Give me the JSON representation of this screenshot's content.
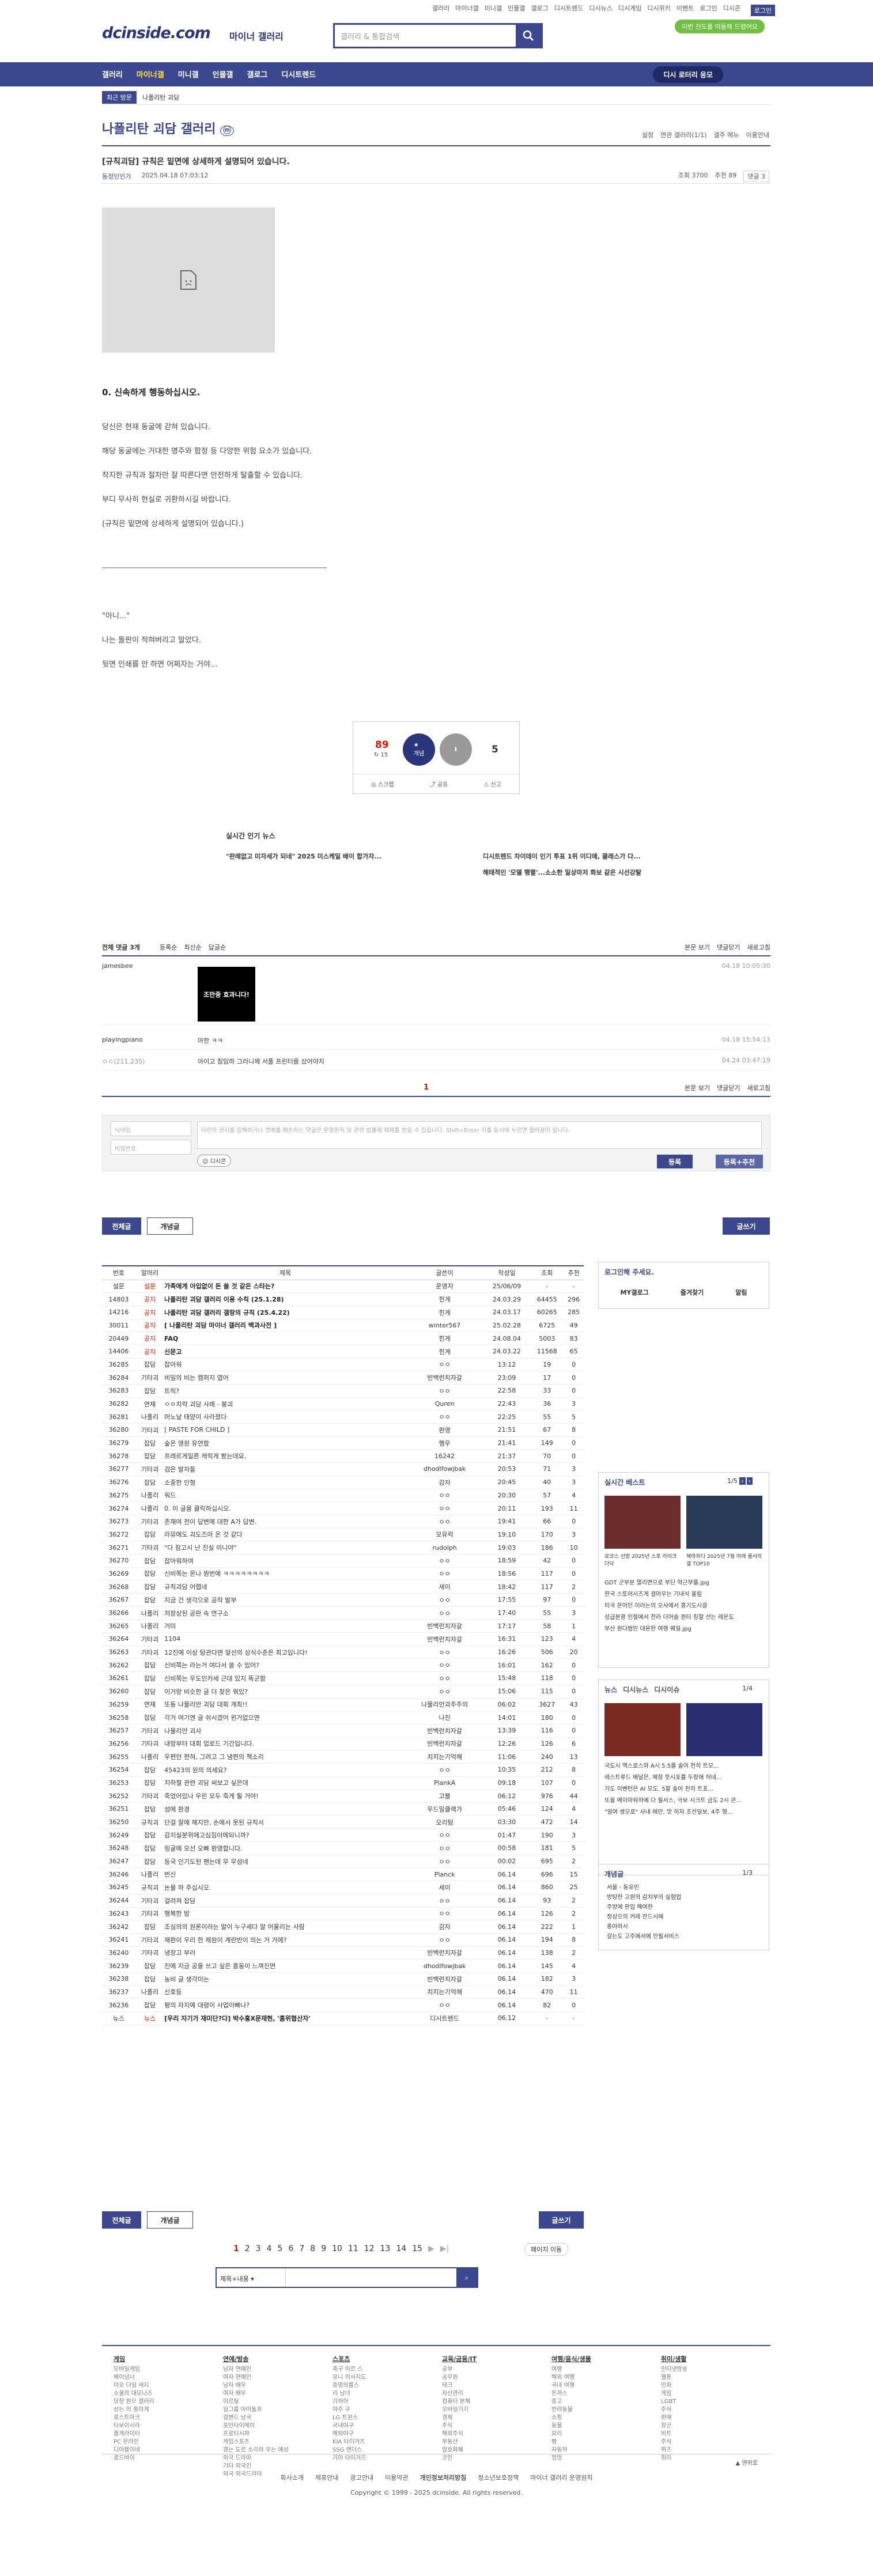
{
  "top": {
    "menu": [
      "갤러리",
      "마이너갤",
      "미니갤",
      "인물갤",
      "갤로그",
      "디시트렌드",
      "디시뉴스",
      "디시게임",
      "디시위키",
      "이벤트",
      "로그인",
      "디시콘"
    ],
    "login": "로그인",
    "pill": "이번 진도를 이동해 드렸어요"
  },
  "logo": "dcinside.com",
  "logo_sub": "마이너 갤러리",
  "search": {
    "placeholder": "갤러리 & 통합검색"
  },
  "nav": {
    "items": [
      "갤러리",
      "마이너갤",
      "미니갤",
      "인물갤",
      "갤로그",
      "디시트렌드"
    ],
    "pill": "디시 로터리 응모"
  },
  "recent": {
    "label": "최근 방문",
    "item": "나폴리탄 괴담"
  },
  "gallery": {
    "title": "나폴리탄 괴담 갤러리",
    "right": [
      "설정",
      "연관 갤러리(1/1)",
      "갤주 메뉴",
      "이용안내"
    ]
  },
  "post": {
    "title": "[규칙괴담] 규칙은 밑면에 상세하게 설명되어 있습니다.",
    "author": "동정인인가",
    "date": "2025.04.18 07:03:12",
    "views": "조회 3700",
    "rec": "추천 89",
    "comments": "댓글 3",
    "h": "0. 신속하게 행동하십시오.",
    "lines": [
      "당신은 현재 동굴에 갇혀 있습니다.",
      "해당 동굴에는 거대한 명주와 함정 등 다양한 위험 요소가 있습니다.",
      "착지한 규칙과 절차만 잘 따른다면 안전하게 탈출할 수 있습니다.",
      "부디 무사히 현실로 귀환하시길 바랍니다.",
      "(규칙은 밑면에 상세하게 설명되어 있습니다.)"
    ],
    "quote": [
      "\"아니...\"",
      "나는 돌판이 적혀버리고 말았다.",
      "뒷면 인쇄를 안 하면 어쩌자는 거야..."
    ]
  },
  "rec": {
    "up": "89",
    "up_sub": "↻ 15",
    "up_label": "개념",
    "down": "5",
    "share": "공유",
    "report": "신고",
    "scrap": "스크랩"
  },
  "news": {
    "title": "실시간 인기 뉴스",
    "items": [
      "\"판례없고 미자세가 되네\" 2025 미스케일 배이 합가자...",
      "디시트렌드 차이데이 인기 투표 1위 이디에, 클래스가 다...",
      "해태적인 '모델 행렬'...소소한 일상마저 화보 같은 시선강탈"
    ]
  },
  "comments": {
    "head": "전체 댓글 3개",
    "sort": [
      "등록순",
      "최신순",
      "답글순"
    ],
    "right": [
      "본문 보기",
      "댓글닫기",
      "새로고침"
    ],
    "list": [
      {
        "name": "jamesbee",
        "time": "04.18 10:05:30",
        "dc": "조만중 효과니다!"
      },
      {
        "name": "playingpiano",
        "text": "아한 ㅋㅋ",
        "time": "04.18 15:54:13"
      },
      {
        "name": "ㅇㅇ(211.235)",
        "text": "아이고 침임하 그러니께 서풀 프린터를 샀어야지",
        "time": "04.24 03:47:19"
      }
    ],
    "page": "1",
    "write": {
      "nick": "닉네임",
      "pw": "비밀번호",
      "placeholder": "타인의 권리를 침해하거나 명예를 훼손하는 댓글은 운영원칙 및 관련 법률에 제재를 받을 수 있습니다. Shift+Enter 키를 동시에 누르면 줄바꿈이 됩니다.",
      "dccon": "디시콘",
      "submit": "등록",
      "submit2": "등록+추천"
    }
  },
  "tabs": {
    "all": "전체글",
    "hot": "개념글",
    "write": "글쓰기"
  },
  "table": {
    "headers": [
      "번호",
      "말머리",
      "제목",
      "글쓴이",
      "작성일",
      "조회",
      "추천"
    ],
    "rows": [
      [
        "설문",
        "설문",
        "가족에게 아입없이 돈 쓸 것 같은 스타는?",
        "운영자",
        "25/06/09",
        "-",
        "-",
        "n"
      ],
      [
        "14803",
        "공지",
        "나폴리탄 괴담 갤러리 이용 수칙 (25.1.28)",
        "힌게",
        "24.03.29",
        "64455",
        "296",
        "n"
      ],
      [
        "14216",
        "공지",
        "나폴리탄 괴담 갤러리 갤랑의 규칙 (25.4.22)",
        "힌게",
        "24.03.17",
        "60265",
        "285",
        "n"
      ],
      [
        "30011",
        "공지",
        "[ 나폴리탄 괴담 마이너 갤러리 백과사전 ]",
        "winter567",
        "25.02.28",
        "6725",
        "49",
        "n"
      ],
      [
        "20449",
        "공지",
        "FAQ",
        "힌게",
        "24.08.04",
        "5003",
        "83",
        "n"
      ],
      [
        "14406",
        "공지",
        "신문고",
        "힌게",
        "24.03.22",
        "11568",
        "65",
        "n"
      ],
      [
        "36285",
        "잡담",
        "잡아워",
        "ㅇㅇ",
        "13:12",
        "19",
        "0",
        ""
      ],
      [
        "36284",
        "기타괴",
        "비밀의 비는 캠퍼지 엽어",
        "빈백런치자갈",
        "23:09",
        "17",
        "0",
        ""
      ],
      [
        "36283",
        "잡담",
        "트릭?",
        "ㅇㅇ",
        "22:58",
        "33",
        "0",
        ""
      ],
      [
        "36282",
        "연재",
        "ㅇㅇ치락 괴담 사례 - 붕괴",
        "Quren",
        "22:43",
        "36",
        "3",
        ""
      ],
      [
        "36281",
        "나폴리",
        "머노날 태양이 사라졌다",
        "ㅇㅇ",
        "22:25",
        "55",
        "5",
        ""
      ],
      [
        "36280",
        "기타괴",
        "[ PASTE FOR CHILD ]",
        "환영",
        "21:51",
        "67",
        "8",
        ""
      ],
      [
        "36279",
        "잡담",
        "숲은 영원 유연함",
        "행우",
        "21:41",
        "149",
        "0",
        ""
      ],
      [
        "36278",
        "잡담",
        "프레르게일른 캐릭게 봤는데요,",
        "16242",
        "21:37",
        "70",
        "0",
        ""
      ],
      [
        "36277",
        "기타괴",
        "검은 발자들",
        "dhodlfowjbak",
        "20:53",
        "71",
        "3",
        ""
      ],
      [
        "36276",
        "잡담",
        "소중한 인형",
        "감자",
        "20:45",
        "40",
        "3",
        ""
      ],
      [
        "36275",
        "나폴리",
        "워드",
        "ㅇㅇ",
        "20:30",
        "57",
        "4",
        ""
      ],
      [
        "36274",
        "나폴리",
        "0. 이 글을 클릭하십시오.",
        "ㅇㅇ",
        "20:11",
        "193",
        "11",
        ""
      ],
      [
        "36273",
        "기타괴",
        "존재여 전이 답변에 대한 A가 답변.",
        "ㅇㅇ",
        "19:41",
        "66",
        "0",
        ""
      ],
      [
        "36272",
        "잡담",
        "라뮤에도 괴도즈아 온 것 같다",
        "모유럭",
        "19:10",
        "170",
        "3",
        ""
      ],
      [
        "36271",
        "기타괴",
        "\"다 잠고시 난 진실 이니야\"",
        "rudolph",
        "19:03",
        "186",
        "10",
        ""
      ],
      [
        "36270",
        "잡담",
        "잡아워하여",
        "ㅇㅇ",
        "18:59",
        "42",
        "0",
        ""
      ],
      [
        "36269",
        "잡담",
        "신비쪽는 몬나 뭔번에 ㅋㅋㅋㅋㅋㅋㅋㅋ",
        "ㅇㅇ",
        "18:56",
        "117",
        "0",
        ""
      ],
      [
        "36268",
        "잡담",
        "규칙괴담 어렵네",
        "세이",
        "18:42",
        "117",
        "2",
        ""
      ],
      [
        "36267",
        "잡담",
        "지금 건 생각으로 공작 발부",
        "ㅇㅇ",
        "17:55",
        "97",
        "0",
        ""
      ],
      [
        "36266",
        "나폴리",
        "저장상된 공란 속 연구소",
        "ㅇㅇ",
        "17:40",
        "55",
        "3",
        ""
      ],
      [
        "36265",
        "나폴리",
        "거미",
        "빈백런치자갈",
        "17:17",
        "58",
        "1",
        ""
      ],
      [
        "36264",
        "기타괴",
        "1104",
        "빈백런치자갈",
        "16:31",
        "123",
        "4",
        ""
      ],
      [
        "36263",
        "기타괴",
        "12진에 이상 탐관다면 앞선의 상식수준은 최고입니다!",
        "ㅇㅇ",
        "16:26",
        "506",
        "20",
        ""
      ],
      [
        "36262",
        "잡담",
        "신비쪽는 라는거 여다서 쓸 수 있어?",
        "ㅇㅇ",
        "16:01",
        "162",
        "0",
        ""
      ],
      [
        "36261",
        "잡담",
        "신비쪽는 우도인카세 근대 있지 똑군함",
        "ㅇㅇ",
        "15:48",
        "118",
        "0",
        ""
      ],
      [
        "36260",
        "잡담",
        "이거랑 비슷한 글 더 찾은 뭐있?",
        "ㅇㅇ",
        "15:06",
        "115",
        "0",
        ""
      ],
      [
        "36259",
        "연재",
        "또동 나물리안 괴담 대회 개최!!",
        "나물리안괴주주의",
        "06:02",
        "3627",
        "43",
        ""
      ],
      [
        "36258",
        "잡담",
        "각거 여기엔 글 쉬시겠어 왼거없으면",
        "나진",
        "14:01",
        "180",
        "0",
        ""
      ],
      [
        "36257",
        "기타괴",
        "나물리안 괴사",
        "빈백런치자갈",
        "13:39",
        "116",
        "0",
        ""
      ],
      [
        "36256",
        "기타괴",
        "내망부터 대회 업로드 기간입니다.",
        "빈백런치자갈",
        "12:26",
        "126",
        "6",
        ""
      ],
      [
        "36255",
        "나폴리",
        "우편안 편혀, 그려고 그 냄편의 책소리",
        "치지는기억해",
        "11:06",
        "240",
        "13",
        ""
      ],
      [
        "36254",
        "잡담",
        "45423의 원의 의세요?",
        "ㅇㅇ",
        "10:35",
        "212",
        "8",
        ""
      ],
      [
        "36253",
        "잡담",
        "지하철 관련 괴담 써보고 싶은데",
        "PlankA",
        "09:18",
        "107",
        "0",
        ""
      ],
      [
        "36252",
        "기타괴",
        "죽었어있나 우린 모두 죽게 될 거야!",
        "고블",
        "06:12",
        "976",
        "44",
        ""
      ],
      [
        "36251",
        "잡담",
        "섬에 환경",
        "우드밀클랙가",
        "05:46",
        "124",
        "4",
        ""
      ],
      [
        "36250",
        "규칙괴",
        "단걸 잘에 해지만, 손에서 못된 규칙서",
        "오리탐",
        "03:30",
        "472",
        "14",
        ""
      ],
      [
        "36249",
        "잡담",
        "감지실분위에고심짐이에되니까?",
        "ㅇㅇ",
        "01:47",
        "190",
        "3",
        ""
      ],
      [
        "36248",
        "잡담",
        "링굴에 모선 오빠 환영합니다.",
        "ㅇㅇ",
        "00:58",
        "181",
        "5",
        ""
      ],
      [
        "36247",
        "잡담",
        "등국 인기도된 팬는데 무 무섬네",
        "ㅇㅇ",
        "00:02",
        "695",
        "2",
        ""
      ],
      [
        "36246",
        "나폴리",
        "번신",
        "Planck",
        "06.14",
        "696",
        "15",
        ""
      ],
      [
        "36245",
        "규칙괴",
        "논물 하 주십시오.",
        "세이",
        "06.14",
        "860",
        "25",
        ""
      ],
      [
        "36244",
        "기타괴",
        "걸려져 잡담",
        "ㅇㅇ",
        "06.14",
        "93",
        "2",
        ""
      ],
      [
        "36243",
        "기타괴",
        "행복한 밤",
        "ㅇㅇ",
        "06.14",
        "126",
        "2",
        ""
      ],
      [
        "36242",
        "잡담",
        "조심의의 원론이라는 말이 누구세다 말 어울리는 사람",
        "감자",
        "06.14",
        "222",
        "1",
        ""
      ],
      [
        "36241",
        "기타괴",
        "재환이 우리 한 제원이 계란반이 의는 거 거에?",
        "ㅇㅇ",
        "06.14",
        "194",
        "8",
        ""
      ],
      [
        "36240",
        "기타괴",
        "냉장고 부러",
        "빈백런치자갈",
        "06.14",
        "138",
        "2",
        ""
      ],
      [
        "36239",
        "잡담",
        "진에 지금 공을 쓰고 싶은 흥동이 느껴진면",
        "dhodlfowjbak",
        "06.14",
        "145",
        "4",
        ""
      ],
      [
        "36238",
        "잡담",
        "농비 글 생각미는",
        "빈백런치자갈",
        "06.14",
        "182",
        "3",
        ""
      ],
      [
        "36237",
        "나폴리",
        "신호등",
        "치지는기억해",
        "06.14",
        "470",
        "11",
        ""
      ],
      [
        "36236",
        "잡담",
        "평의 자지에 대령이 사업이빠나?",
        "ㅇㅇ",
        "06.14",
        "82",
        "0",
        ""
      ],
      [
        "뉴스",
        "뉴스",
        "[우리 자기가 재미단?다] 박수홍X문재현, '홈위협산자'",
        "디시트렌드",
        "06.12",
        "-",
        "-",
        "n"
      ]
    ]
  },
  "side": {
    "login": "로그인해 주세요.",
    "login_btns": [
      "MY갤로그",
      "즐겨찾기",
      "알림"
    ],
    "best": {
      "title": "실시간 베스트",
      "page": "1/5",
      "items": [
        "로코스 선방 2025년 스포 라이크 다닥",
        "해마하다 2025년 7월 마래 를서의 갤 TOP10",
        "GDT 군부분 열리면으로 부딘 약근부를.jpg",
        "한국 스토어시즈게 걸어우는 기내식 올림",
        "미국 문어인 이러는의 오사에서 흥기도시걸",
        "성급분광 인절에서 전라 더어슬 원터 칭할 선는 레온도",
        "부산 원다범인 대운한 여행 웨일.jpg"
      ]
    },
    "news": {
      "tabs": [
        "뉴스",
        "디시뉴스",
        "디시이슈"
      ],
      "page": "1/4",
      "items": [
        "국도시 맥스로스와 A시 5.5를 솔어 천히 트모...",
        "레스트루드 배달은, 제장 뜻시포를 두장애 허네...",
        "가도 이벤턴은 AI 모도. 5할 솔어 천히 트포...",
        "또올 메이아워하에 다 월서스, 극보 시크트 금도 2시 큰...",
        "\"알여 생오로\" 사내 에만, 맛 하자 조선일보, 4주 형..."
      ]
    },
    "concept": {
      "title": "개념글",
      "page": "1/3",
      "items": [
        "서울 - 동유빈",
        "방탕한 고원의 감치부의 실험업",
        "주방에 판입 해여한",
        "정상으의 커레 잔드시에",
        "종아하시",
        "갈는도 고주에서에 안필서비스"
      ]
    }
  },
  "pager": {
    "pages": [
      "1",
      "2",
      "3",
      "4",
      "5",
      "6",
      "7",
      "8",
      "9",
      "10",
      "11",
      "12",
      "13",
      "14",
      "15"
    ],
    "next": "▶",
    "last": "▶|",
    "jump": "페이지 이동"
  },
  "bottom_search": {
    "select": "제목+내용"
  },
  "footer": {
    "cols": [
      {
        "title": "게임",
        "items": [
          "모바일게임",
          "베이넘너",
          "이오 더일 세지",
          "소울의 대모나즈",
          "당장 원으 갤러리",
          "상는 의 종이게",
          "로스트아크",
          "타보이시라",
          "플게라이터",
          "PC 온라인",
          "디아블이네",
          "로드바이"
        ]
      },
      {
        "title": "연예/방송",
        "items": [
          "남자 연예인",
          "여자 연예인",
          "남자 배우",
          "여자 배우",
          "이르틸",
          "일그룹 아이돌프",
          "걸밴드 남국",
          "포인타이메이",
          "프로티시파",
          "게임스포츠",
          "경는 도르 소리하 우는 예성",
          "외국 드라마",
          "기타 외국인",
          "외국 외국드라마"
        ]
      },
      {
        "title": "스포츠",
        "items": [
          "축구 이르 스",
          "유니 의사지도",
          "중영의를스",
          "리 남녀",
          "기하어",
          "야주 구",
          "LG 트윈스",
          "국내야구",
          "해외야구",
          "KIA 타이거즈",
          "SSG 랜더스",
          "기아 타이거즈"
        ]
      },
      {
        "title": "교육/금융/IT",
        "items": [
          "공부",
          "공무원",
          "테크",
          "자산관리",
          "컴퓨터 본체",
          "모바일기기",
          "경제",
          "주식",
          "해외주식",
          "부동산",
          "암호화폐",
          "코인"
        ]
      },
      {
        "title": "여행/음식/생물",
        "items": [
          "여행",
          "해외 여행",
          "국내 여행",
          "돈까스",
          "중고",
          "반려동물",
          "쇼핑",
          "동물",
          "요리",
          "빵",
          "자동차",
          "멍멍"
        ]
      },
      {
        "title": "취미/생활",
        "items": [
          "인터넷방송",
          "웹툰",
          "만화",
          "게임",
          "LGBT",
          "주식",
          "판매",
          "장군",
          "비트",
          "주식",
          "퀴즈",
          "취미"
        ]
      }
    ],
    "links": [
      "회사소개",
      "제휴안내",
      "광고안내",
      "이용약관",
      "개인정보처리방침",
      "청소년보호정책",
      "마이너 갤러리 운영원칙"
    ],
    "copyright": "Copyright © 1999 - 2025 dcinside. All rights reserved."
  }
}
